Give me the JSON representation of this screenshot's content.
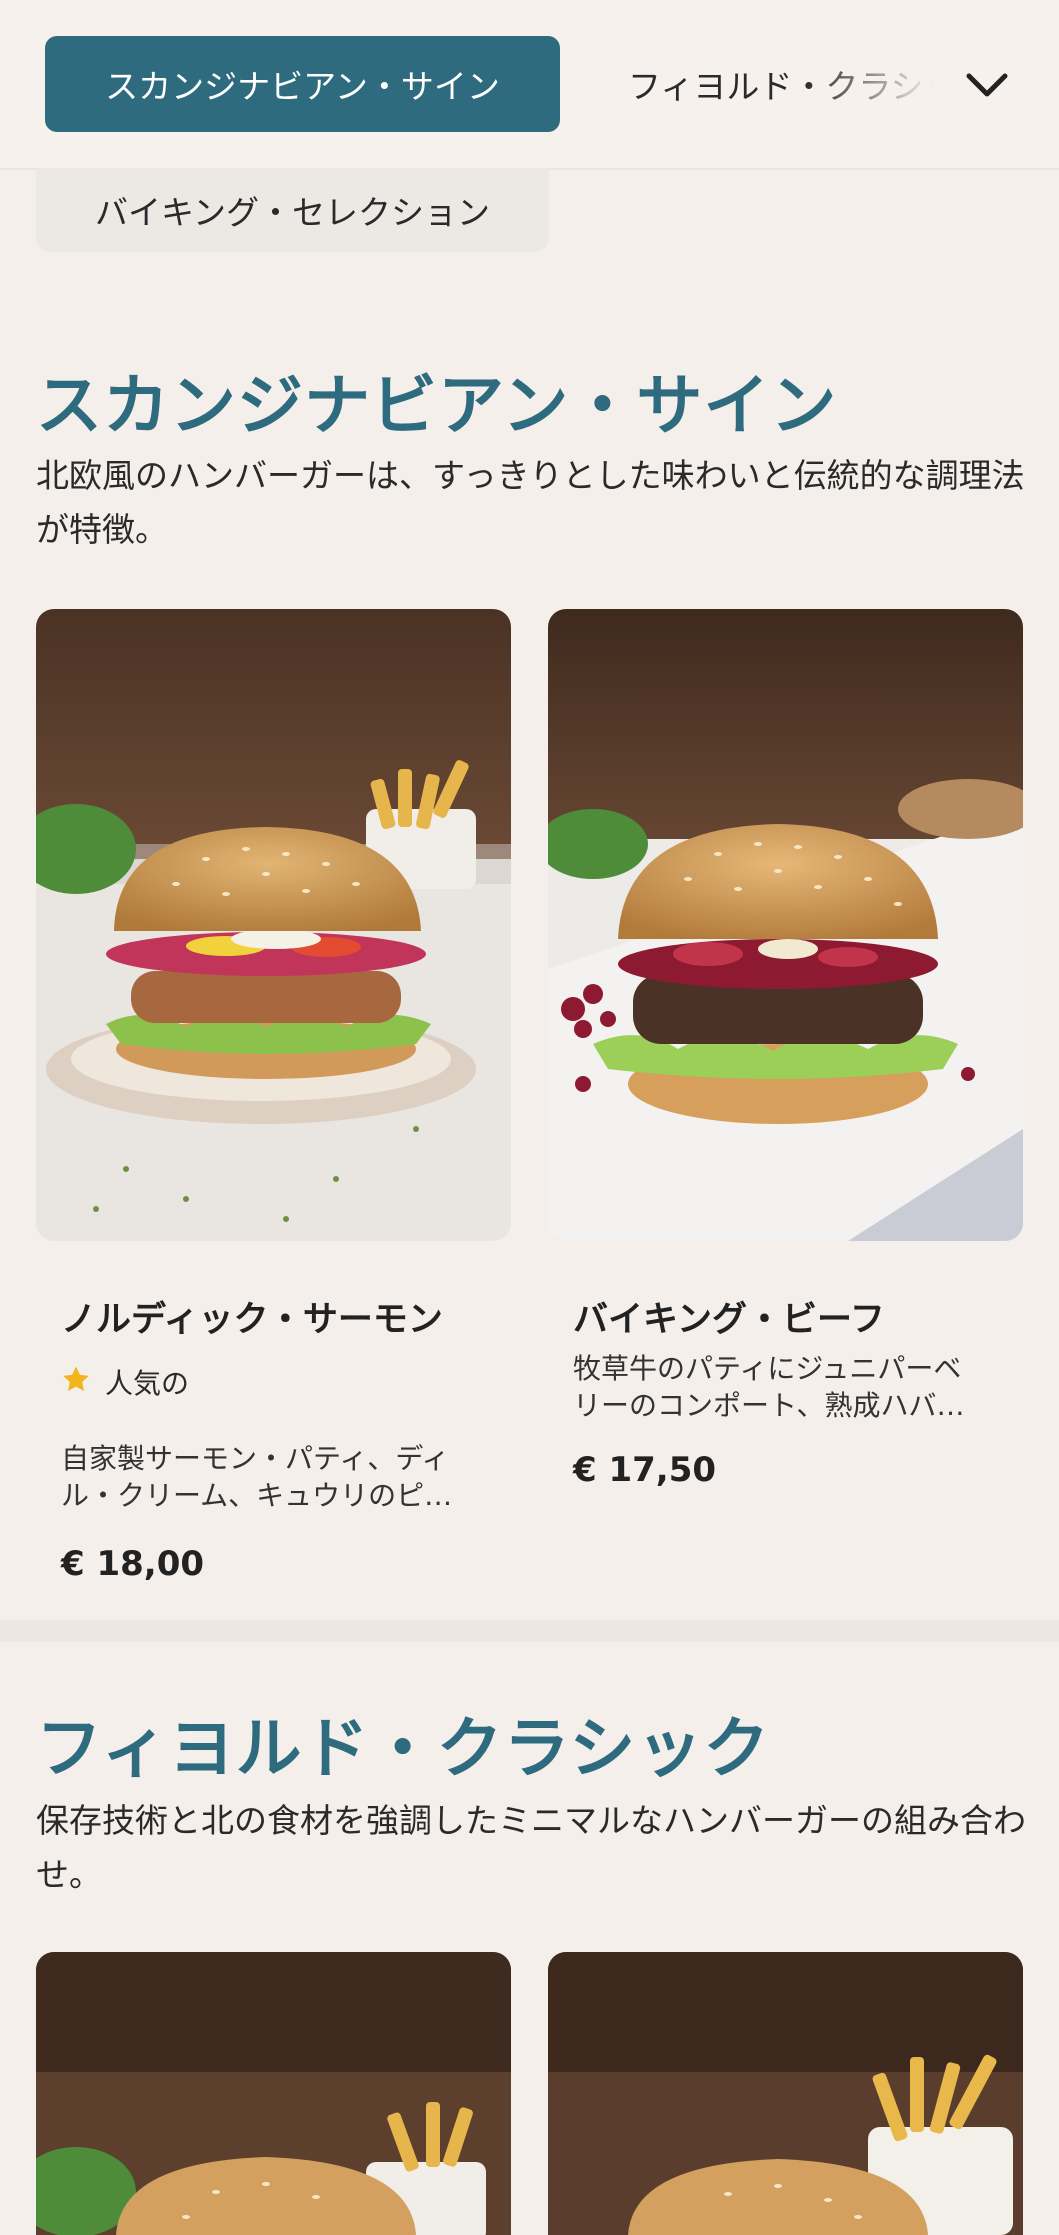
{
  "nav": {
    "active_category": "スカンジナビアン・サイン",
    "next_category": "フィヨルド・クラシック",
    "third_category": "バイキング・セレクション",
    "expand_icon": "chevron-down-icon"
  },
  "sections": [
    {
      "title": "スカンジナビアン・サイン",
      "description": "北欧風のハンバーガーは、すっきりとした味わいと伝統的な調理法が特徴。",
      "items": [
        {
          "name": "ノルディック・サーモン",
          "badge": "人気の",
          "badge_icon": "star-icon",
          "description": "自家製サーモン・パティ、ディル・クリーム、キュウリのピクルス",
          "price": "€ 18,00"
        },
        {
          "name": "バイキング・ビーフ",
          "description": "牧草牛のパティにジュニパーベリーのコンポート、熟成ハバ…",
          "price": "€ 17,50"
        }
      ]
    },
    {
      "title": "フィヨルド・クラシック",
      "description": "保存技術と北の食材を強調したミニマルなハンバーガーの組み合わせ。"
    }
  ],
  "colors": {
    "accent": "#2e6b7e",
    "background": "#f5efeb",
    "star": "#f2b61c"
  }
}
